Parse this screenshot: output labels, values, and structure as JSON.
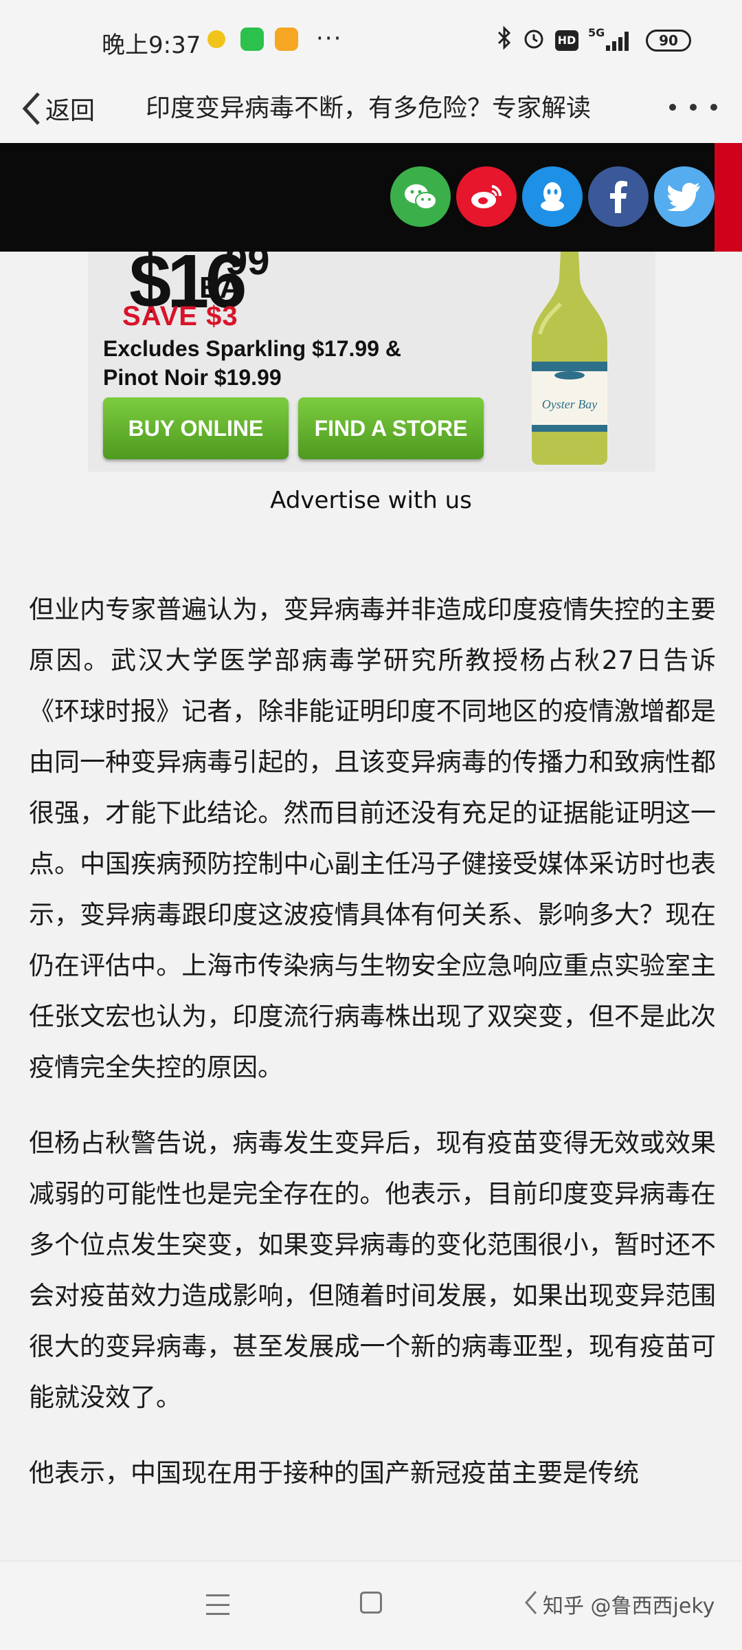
{
  "status_bar": {
    "time": "晚上9:37",
    "dots": "···",
    "network": "5G",
    "hd": "HD",
    "battery": "90"
  },
  "nav": {
    "back_label": "返回",
    "title": "印度变异病毒不断，有多危险？专家解读"
  },
  "share": {
    "buttons": [
      "wechat-icon",
      "weibo-icon",
      "qq-icon",
      "facebook-icon",
      "twitter-icon"
    ],
    "colors": {
      "wechat": "#3bb04a",
      "weibo": "#e6162d",
      "qq": "#1e90e6",
      "facebook": "#3b5998",
      "twitter": "#55acee"
    }
  },
  "ad": {
    "price": "$16",
    "cents": "99",
    "unit": "EA",
    "save": "SAVE $3",
    "excludes_line1": "Excludes Sparkling $17.99 &",
    "excludes_line2": "Pinot Noir $19.99",
    "buy_online": "BUY ONLINE",
    "find_store": "FIND A STORE",
    "bottle_label": "Oyster Bay"
  },
  "advertise_label": "Advertise with us",
  "article": {
    "paragraphs": [
      "但业内专家普遍认为，变异病毒并非造成印度疫情失控的主要原因。武汉大学医学部病毒学研究所教授杨占秋27日告诉《环球时报》记者，除非能证明印度不同地区的疫情激增都是由同一种变异病毒引起的，且该变异病毒的传播力和致病性都很强，才能下此结论。然而目前还没有充足的证据能证明这一点。中国疾病预防控制中心副主任冯子健接受媒体采访时也表示，变异病毒跟印度这波疫情具体有何关系、影响多大？现在仍在评估中。上海市传染病与生物安全应急响应重点实验室主任张文宏也认为，印度流行病毒株出现了双突变，但不是此次疫情完全失控的原因。",
      "但杨占秋警告说，病毒发生变异后，现有疫苗变得无效或效果减弱的可能性也是完全存在的。他表示，目前印度变异病毒在多个位点发生突变，如果变异病毒的变化范围很小，暂时还不会对疫苗效力造成影响，但随着时间发展，如果出现变异范围很大的变异病毒，甚至发展成一个新的病毒亚型，现有疫苗可能就没效了。",
      "他表示，中国现在用于接种的国产新冠疫苗主要是传统"
    ]
  },
  "bottom_nav": {
    "watermark": "知乎 @鲁西西jeky"
  }
}
